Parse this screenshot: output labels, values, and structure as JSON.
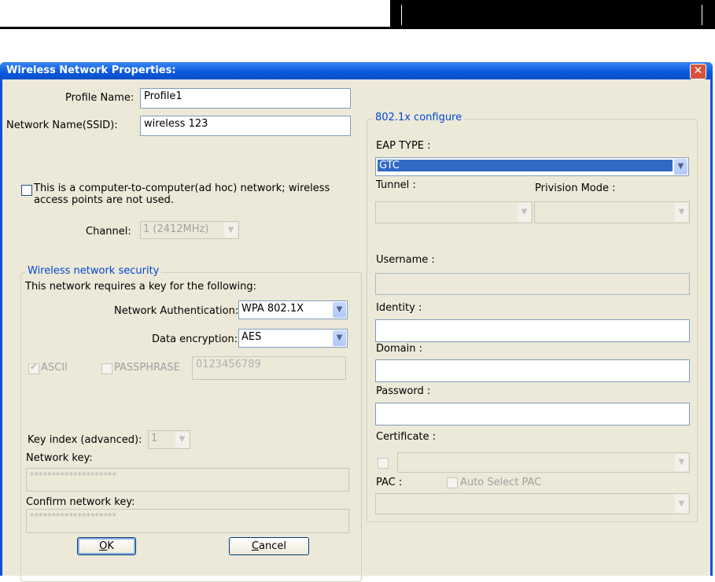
{
  "window": {
    "title": "Wireless Network Properties:",
    "close_glyph": "✕"
  },
  "profile": {
    "profile_name_label": "Profile Name:",
    "profile_name_value": "Profile1",
    "ssid_label": "Network Name(SSID):",
    "ssid_value": "wireless 123"
  },
  "adhoc": {
    "line1": "This is a computer-to-computer(ad hoc) network; wireless",
    "line2": "access points are not used.",
    "checked": false,
    "channel_label": "Channel:",
    "channel_value": "1  (2412MHz)"
  },
  "security": {
    "legend": "Wireless network security",
    "intro": "This network requires a key for the following:",
    "auth_label": "Network Authentication:",
    "auth_value": "WPA 802.1X",
    "enc_label": "Data encryption:",
    "enc_value": "AES",
    "ascii_label": "ASCII",
    "passphrase_label": "PASSPHRASE",
    "passphrase_value": "0123456789",
    "key_index_label": "Key index (advanced):",
    "key_index_value": "1",
    "network_key_label": "Network key:",
    "network_key_value": "********************",
    "confirm_key_label": "Confirm network key:",
    "confirm_key_value": "********************"
  },
  "dot1x": {
    "legend": "802.1x configure",
    "eap_type_label": "EAP TYPE :",
    "eap_type_value": "GTC",
    "tunnel_label": "Tunnel :",
    "provision_label": "Privision Mode :",
    "username_label": "Username :",
    "identity_label": "Identity :",
    "domain_label": "Domain :",
    "password_label": "Password :",
    "certificate_label": "Certificate :",
    "pac_label": "PAC :",
    "auto_select_pac_label": "Auto Select PAC"
  },
  "buttons": {
    "ok_mnemonic": "O",
    "ok_rest": "K",
    "cancel_mnemonic": "C",
    "cancel_rest": "ancel"
  },
  "icons": {
    "dropdown": "chevron-down-icon",
    "close": "close-icon",
    "check": "checkmark-icon"
  }
}
